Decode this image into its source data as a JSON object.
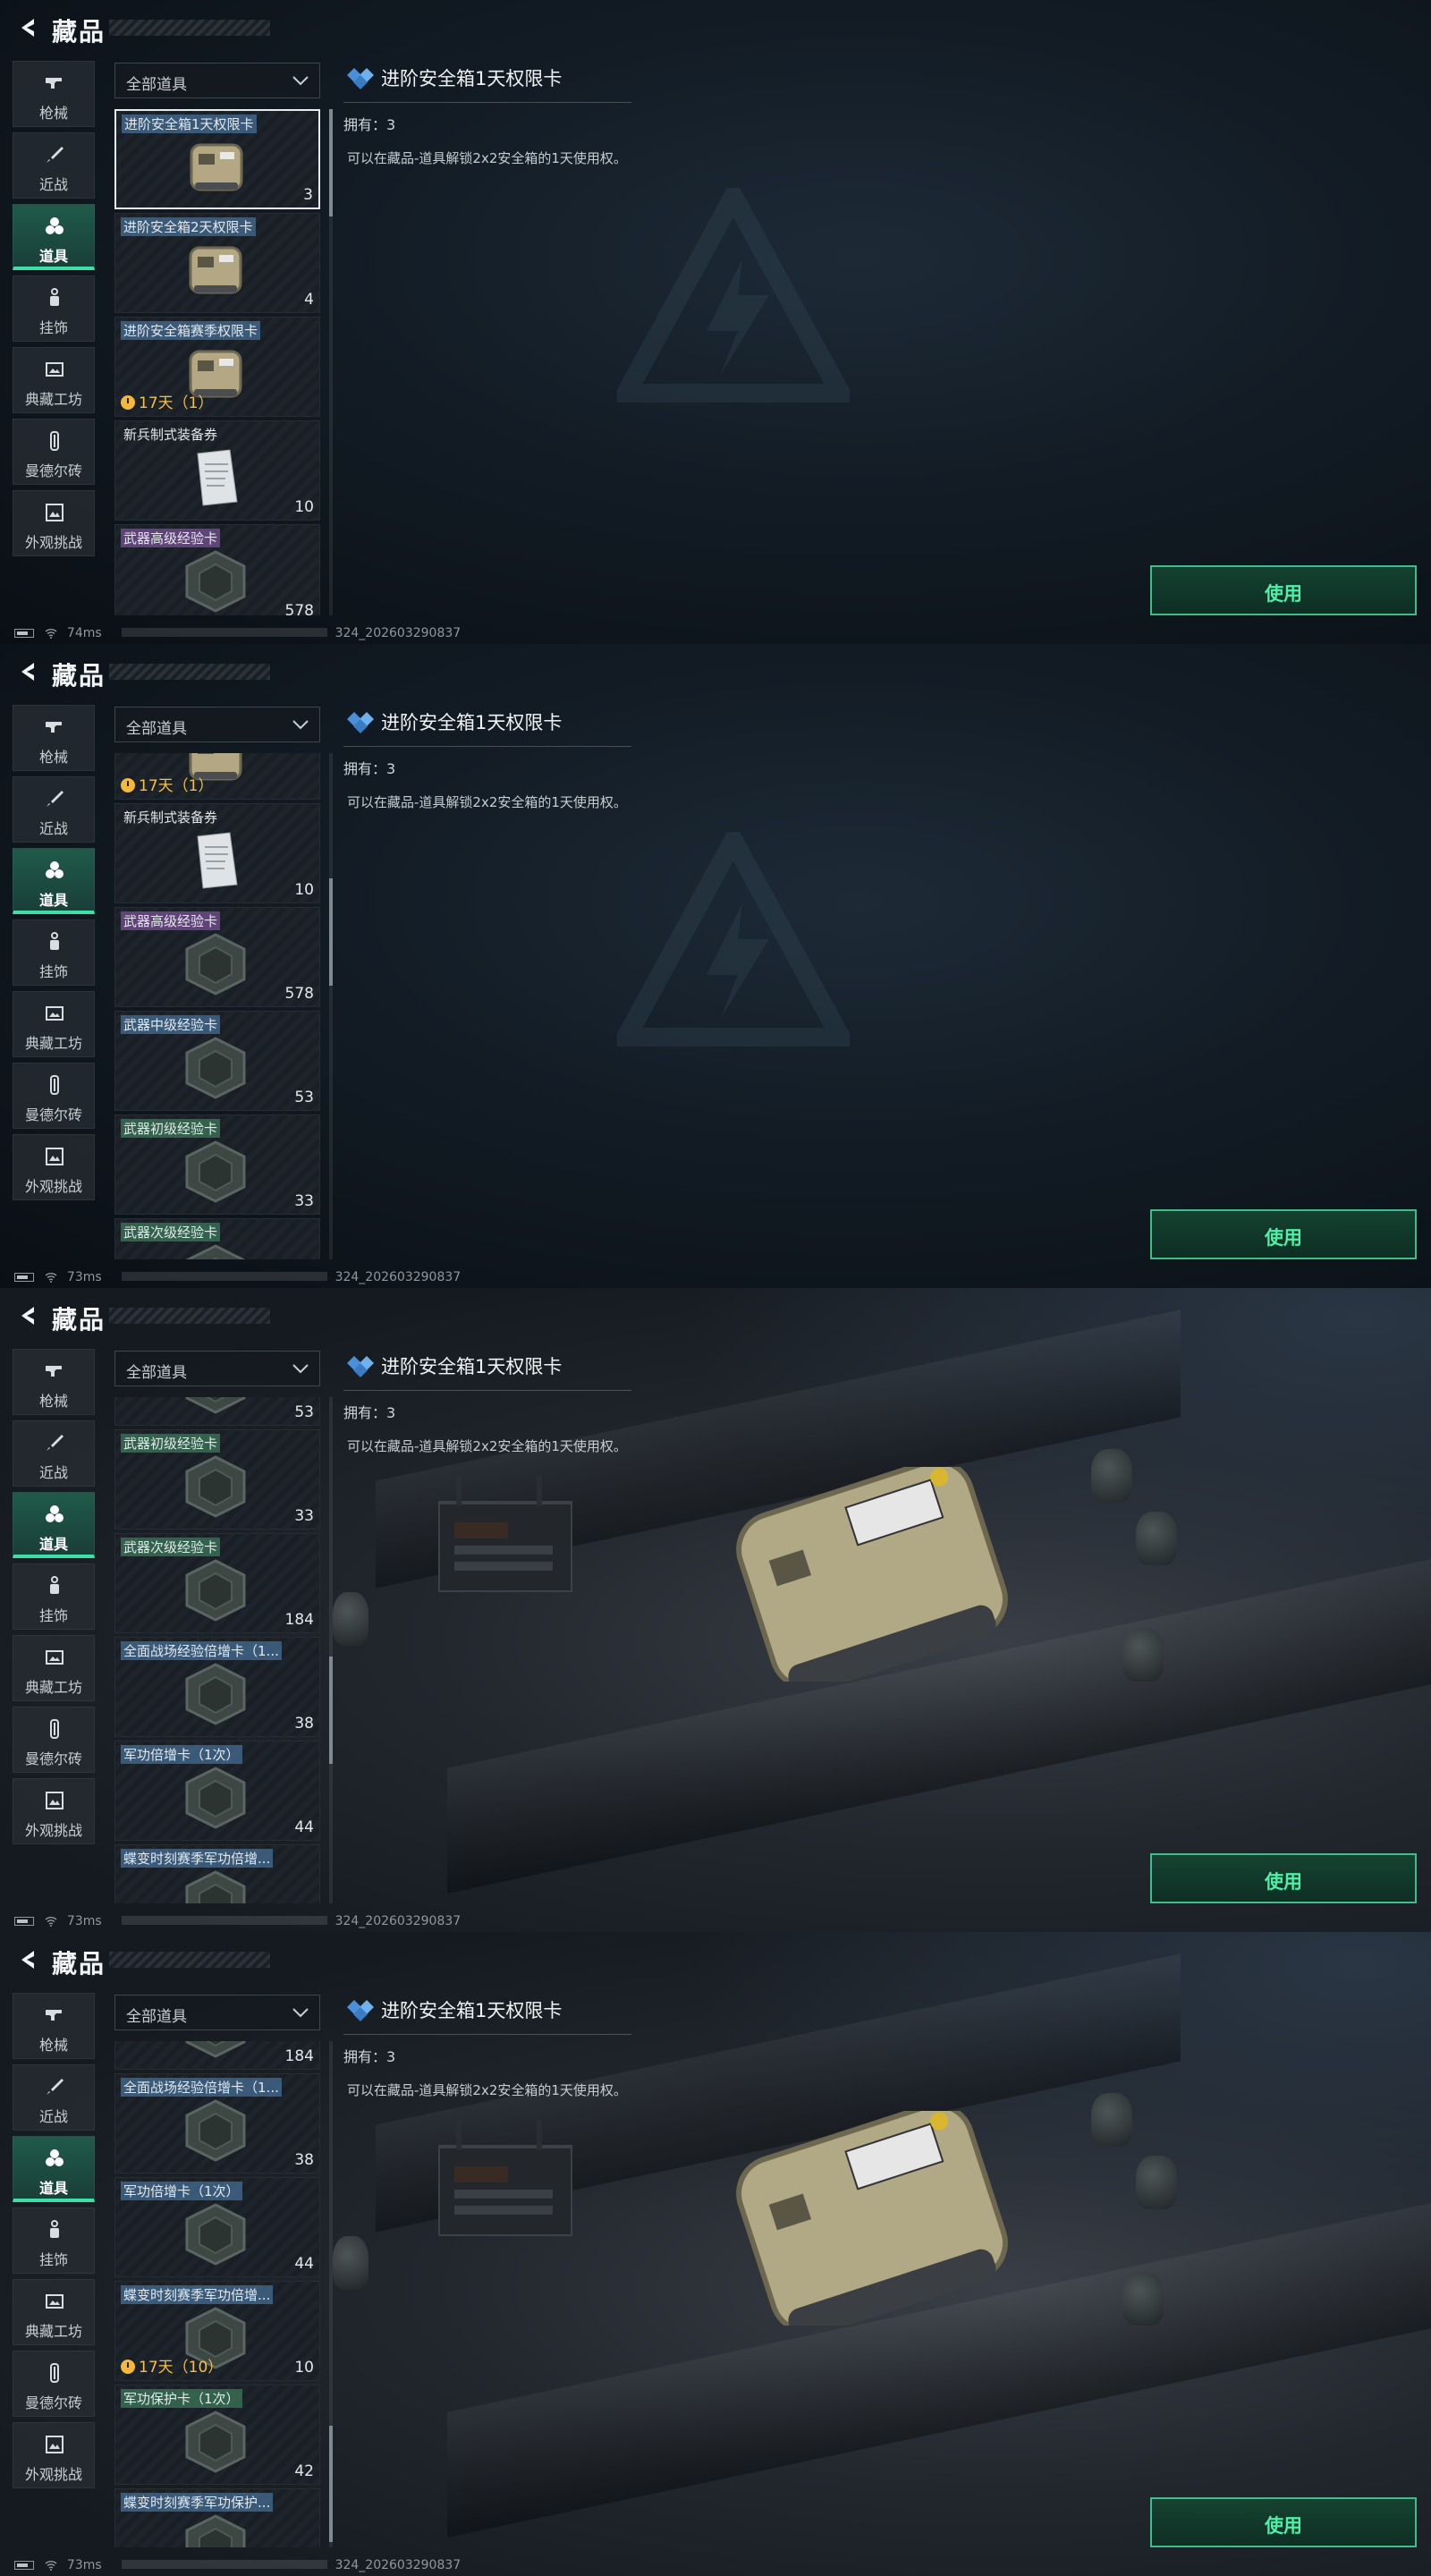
{
  "header": {
    "title": "藏品"
  },
  "sidebar": {
    "items": [
      {
        "label": "枪械",
        "icon": "gun-icon",
        "active": false
      },
      {
        "label": "近战",
        "icon": "knife-icon",
        "active": false
      },
      {
        "label": "道具",
        "icon": "items-icon",
        "active": true
      },
      {
        "label": "挂饰",
        "icon": "charm-icon",
        "active": false
      },
      {
        "label": "典藏工坊",
        "icon": "workshop-icon",
        "active": false
      },
      {
        "label": "曼德尔砖",
        "icon": "brick-icon",
        "active": false
      },
      {
        "label": "外观挑战",
        "icon": "challenge-icon",
        "active": false
      }
    ]
  },
  "filter": {
    "label": "全部道具"
  },
  "detail": {
    "title": "进阶安全箱1天权限卡",
    "owned": "拥有：3",
    "description": "可以在藏品-道具解锁2x2安全箱的1天使用权。"
  },
  "use_button": {
    "label": "使用"
  },
  "accent_color": "#3fe0a8",
  "panels": [
    {
      "status": {
        "latency": "74ms",
        "code": "324_202603290837"
      },
      "cards": [
        {
          "name": "进阶安全箱1天权限卡",
          "count": "3",
          "timer": "",
          "tag": "blue",
          "img": "safebox",
          "selected": true
        },
        {
          "name": "进阶安全箱2天权限卡",
          "count": "4",
          "timer": "",
          "tag": "blue",
          "img": "safebox",
          "selected": false
        },
        {
          "name": "进阶安全箱赛季权限卡",
          "count": "",
          "timer": "17天（1）",
          "tag": "blue",
          "img": "safebox",
          "selected": false
        },
        {
          "name": "新兵制式装备券",
          "count": "10",
          "timer": "",
          "tag": "none",
          "img": "paper",
          "selected": false
        },
        {
          "name": "武器高级经验卡",
          "count": "578",
          "timer": "",
          "tag": "purple",
          "img": "hex",
          "selected": false
        }
      ]
    },
    {
      "status": {
        "latency": "73ms",
        "code": "324_202603290837"
      },
      "cards": [
        {
          "name": "",
          "count": "",
          "timer": "17天（1）",
          "tag": "none",
          "img": "safebox",
          "selected": false
        },
        {
          "name": "新兵制式装备券",
          "count": "10",
          "timer": "",
          "tag": "none",
          "img": "paper",
          "selected": false
        },
        {
          "name": "武器高级经验卡",
          "count": "578",
          "timer": "",
          "tag": "purple",
          "img": "hex",
          "selected": false
        },
        {
          "name": "武器中级经验卡",
          "count": "53",
          "timer": "",
          "tag": "blue",
          "img": "hex",
          "selected": false
        },
        {
          "name": "武器初级经验卡",
          "count": "33",
          "timer": "",
          "tag": "green",
          "img": "hex",
          "selected": false
        },
        {
          "name": "武器次级经验卡",
          "count": "",
          "timer": "",
          "tag": "green",
          "img": "hex",
          "selected": false
        }
      ]
    },
    {
      "status": {
        "latency": "73ms",
        "code": "324_202603290837"
      },
      "cards": [
        {
          "name": "",
          "count": "53",
          "timer": "",
          "tag": "none",
          "img": "hex",
          "selected": false
        },
        {
          "name": "武器初级经验卡",
          "count": "33",
          "timer": "",
          "tag": "green",
          "img": "hex",
          "selected": false
        },
        {
          "name": "武器次级经验卡",
          "count": "184",
          "timer": "",
          "tag": "green",
          "img": "hex",
          "selected": false
        },
        {
          "name": "全面战场经验倍增卡（1...",
          "count": "38",
          "timer": "",
          "tag": "blue",
          "img": "hex",
          "selected": false
        },
        {
          "name": "军功倍增卡（1次）",
          "count": "44",
          "timer": "",
          "tag": "blue",
          "img": "hex",
          "selected": false
        },
        {
          "name": "蝶变时刻赛季军功倍增...",
          "count": "",
          "timer": "",
          "tag": "blue",
          "img": "hex",
          "selected": false
        }
      ]
    },
    {
      "status": {
        "latency": "73ms",
        "code": "324_202603290837"
      },
      "cards": [
        {
          "name": "",
          "count": "184",
          "timer": "",
          "tag": "none",
          "img": "hex",
          "selected": false
        },
        {
          "name": "全面战场经验倍增卡（1...",
          "count": "38",
          "timer": "",
          "tag": "blue",
          "img": "hex",
          "selected": false
        },
        {
          "name": "军功倍增卡（1次）",
          "count": "44",
          "timer": "",
          "tag": "blue",
          "img": "hex",
          "selected": false
        },
        {
          "name": "蝶变时刻赛季军功倍增...",
          "count": "10",
          "timer": "17天（10）",
          "tag": "blue",
          "img": "hex",
          "selected": false
        },
        {
          "name": "军功保护卡（1次）",
          "count": "42",
          "timer": "",
          "tag": "green",
          "img": "hex",
          "selected": false
        },
        {
          "name": "蝶变时刻赛季军功保护...",
          "count": "",
          "timer": "",
          "tag": "blue",
          "img": "hex",
          "selected": false
        }
      ]
    }
  ]
}
